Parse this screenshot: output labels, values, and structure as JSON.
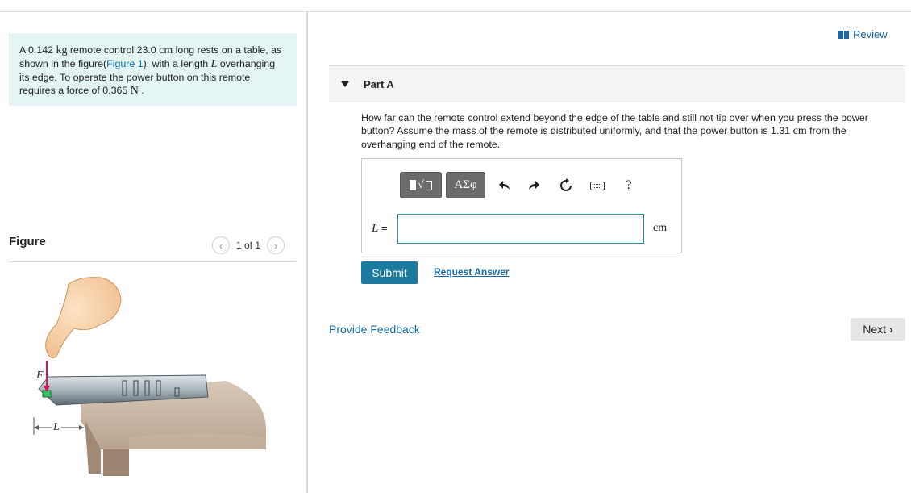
{
  "problem": {
    "p1": "A 0.142 ",
    "unit_kg": "kg",
    "p2": " remote control 23.0 ",
    "unit_cm": "cm",
    "p3": " long rests on a table, as shown in the figure(",
    "figure_link": "Figure 1",
    "p4": "), with a length ",
    "var_L": "L",
    "p5": " overhanging its edge. To operate the power button on this remote requires a force of 0.365 ",
    "unit_N": "N",
    "p6": " ."
  },
  "figure_panel": {
    "title": "Figure",
    "pager_text": "1 of 1",
    "labels": {
      "force": "F",
      "length": "L"
    }
  },
  "review_label": "Review",
  "part": {
    "label": "Part A"
  },
  "question": {
    "q1": "How far can the remote control extend beyond the edge of the table and still not tip over when you press the power button? Assume the mass of the remote is distributed uniformly, and that the power button is 1.31 ",
    "unit_cm": "cm",
    "q2": " from the overhanging end of the remote."
  },
  "toolbar": {
    "greek_label": "ΑΣφ",
    "help_label": "?",
    "icons": [
      "template-icon",
      "greek-icon",
      "undo-icon",
      "redo-icon",
      "reset-icon",
      "keyboard-icon",
      "help-icon"
    ]
  },
  "answer": {
    "var": "L",
    "equals": " =",
    "value": "",
    "unit": "cm"
  },
  "submit_label": "Submit",
  "request_label": "Request Answer",
  "feedback_label": "Provide Feedback",
  "next_label": "Next",
  "colors": {
    "accent": "#1b7a9e",
    "link": "#1a6aa7",
    "problem_bg": "#e5f5f5",
    "force_arrow": "#d2145a"
  }
}
